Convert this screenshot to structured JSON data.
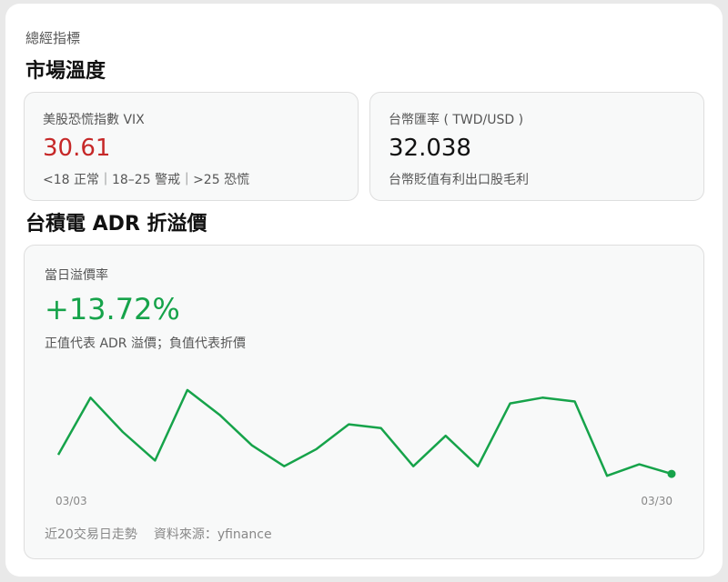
{
  "header": {
    "eyebrow": "總經指標",
    "market_title": "市場溫度"
  },
  "vix": {
    "label": "美股恐慌指數 VIX",
    "value": "30.61",
    "note": "<18 正常｜18–25 警戒｜>25 恐慌",
    "value_color": "#c62828"
  },
  "fx": {
    "label": "台幣匯率 ( TWD/USD )",
    "value": "32.038",
    "note": "台幣貶值有利出口股毛利"
  },
  "adr": {
    "section_title": "台積電 ADR 折溢價",
    "label": "當日溢價率",
    "value": "+13.72%",
    "note": "正值代表 ADR 溢價；負值代表折價",
    "footer_trend": "近20交易日走勢",
    "footer_source": "資料來源：yfinance",
    "accent_color": "#16a34a"
  },
  "chart_data": {
    "type": "line",
    "x_start_label": "03/03",
    "x_end_label": "03/30",
    "series": [
      {
        "values": [
          14.5,
          16.0,
          15.1,
          14.35,
          16.2,
          15.55,
          14.75,
          14.2,
          14.65,
          15.3,
          15.2,
          14.2,
          15.0,
          14.2,
          15.85,
          16.0,
          15.9,
          13.95,
          14.25,
          14.0
        ]
      }
    ],
    "ylim": [
      13.5,
      16.7
    ],
    "grid": false,
    "line_color": "#16a34a"
  }
}
